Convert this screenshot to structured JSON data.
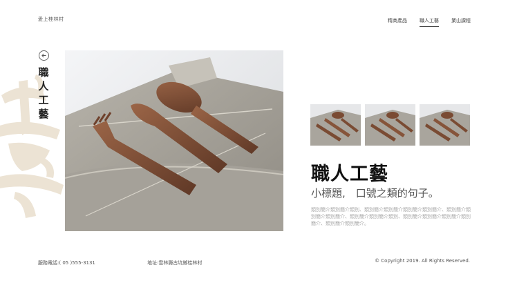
{
  "header": {
    "site_name": "愛上桂林村",
    "nav": [
      {
        "label": "精商產品",
        "active": false
      },
      {
        "label": "職人工藝",
        "active": true
      },
      {
        "label": "業山課程",
        "active": false
      }
    ]
  },
  "sidebar": {
    "title_chars": [
      "職",
      "人",
      "工",
      "藝"
    ],
    "back_icon": "arrow-left-circle-icon"
  },
  "product": {
    "title": "職人工藝",
    "subtitle": "小標題,　口號之類的句子。",
    "description": "類別簡介類別簡介類別、類別簡介類別簡介類別簡介類別簡介、類別簡介類別簡介類別簡介、類別簡介類別簡介類別、類別簡介類別簡介類別簡介類別簡介、類別簡介類別簡介。"
  },
  "footer": {
    "phone": "服務電話:( 05 )555-3131",
    "address": "地址:雲林縣古坑鄉桂林村",
    "copyright": "© Copyright 2019. All Rights Reserved."
  },
  "colors": {
    "accent": "#e8e0d2",
    "wood": "#7a4b33",
    "linen": "#a8a49c"
  }
}
